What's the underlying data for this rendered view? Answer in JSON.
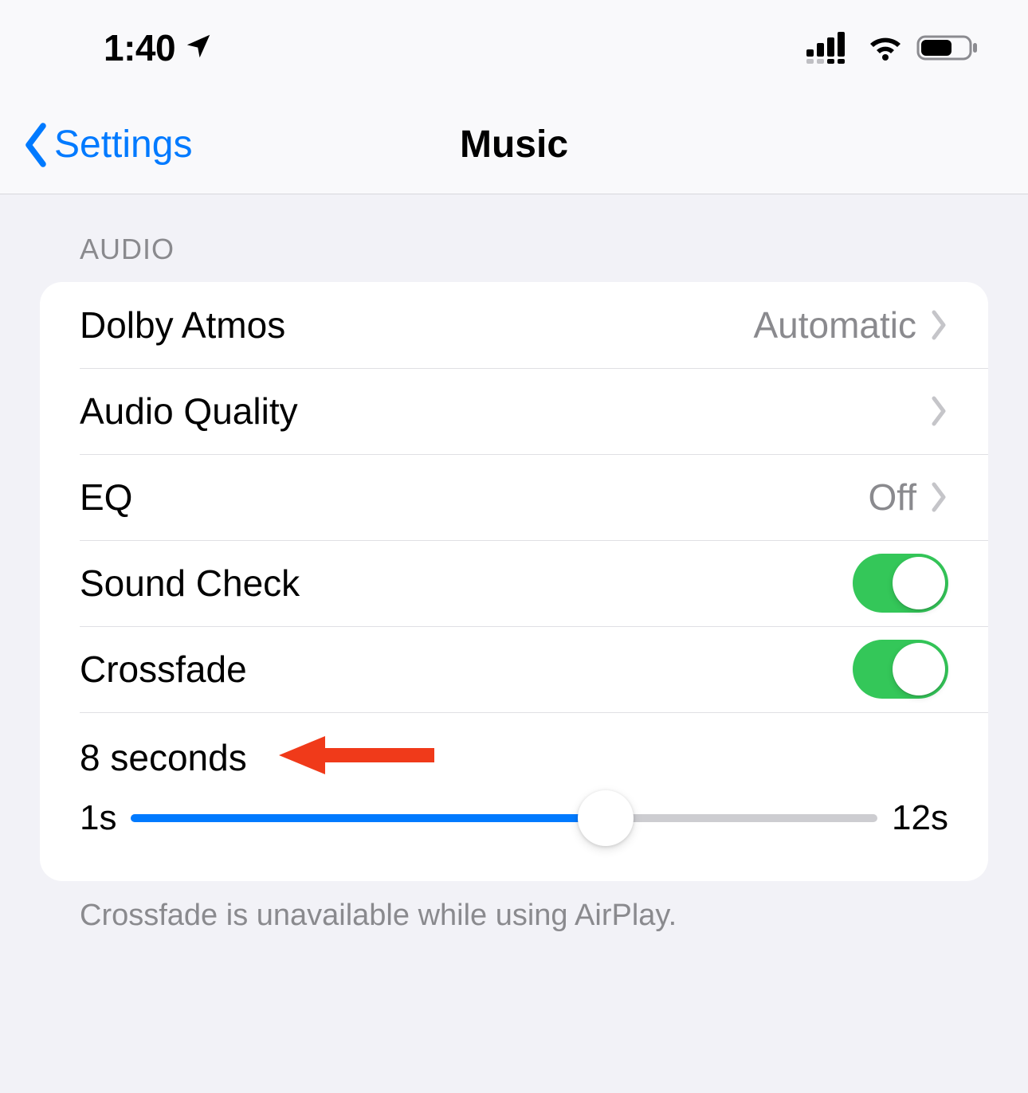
{
  "statusBar": {
    "time": "1:40"
  },
  "nav": {
    "back": "Settings",
    "title": "Music"
  },
  "audio": {
    "header": "AUDIO",
    "rows": {
      "dolby": {
        "label": "Dolby Atmos",
        "value": "Automatic"
      },
      "quality": {
        "label": "Audio Quality"
      },
      "eq": {
        "label": "EQ",
        "value": "Off"
      },
      "soundCheck": {
        "label": "Sound Check",
        "on": true
      },
      "crossfade": {
        "label": "Crossfade",
        "on": true
      }
    },
    "slider": {
      "valueLabel": "8 seconds",
      "min": 1,
      "max": 12,
      "minLabel": "1s",
      "maxLabel": "12s",
      "current": 8
    },
    "footer": "Crossfade is unavailable while using AirPlay."
  },
  "annotation": {
    "arrowColor": "#f03a1a"
  }
}
